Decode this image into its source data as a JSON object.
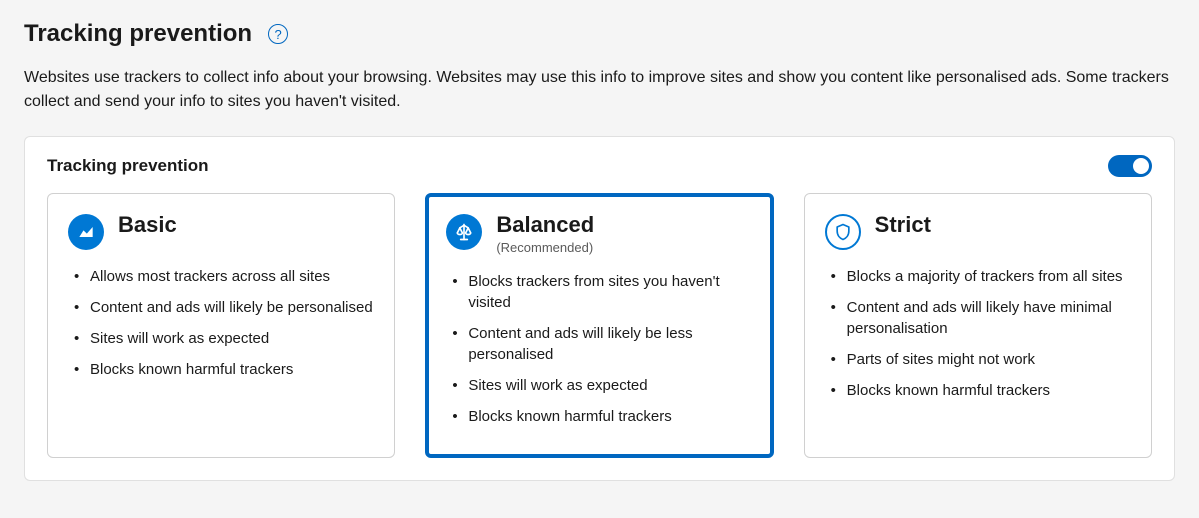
{
  "header": {
    "title": "Tracking prevention",
    "description": "Websites use trackers to collect info about your browsing. Websites may use this info to improve sites and show you content like personalised ads. Some trackers collect and send your info to sites you haven't visited."
  },
  "card": {
    "title": "Tracking prevention",
    "toggle_on": true
  },
  "options": [
    {
      "id": "basic",
      "title": "Basic",
      "subtitle": "",
      "selected": false,
      "bullets": [
        "Allows most trackers across all sites",
        "Content and ads will likely be personalised",
        "Sites will work as expected",
        "Blocks known harmful trackers"
      ]
    },
    {
      "id": "balanced",
      "title": "Balanced",
      "subtitle": "(Recommended)",
      "selected": true,
      "bullets": [
        "Blocks trackers from sites you haven't visited",
        "Content and ads will likely be less personalised",
        "Sites will work as expected",
        "Blocks known harmful trackers"
      ]
    },
    {
      "id": "strict",
      "title": "Strict",
      "subtitle": "",
      "selected": false,
      "bullets": [
        "Blocks a majority of trackers from all sites",
        "Content and ads will likely have minimal personalisation",
        "Parts of sites might not work",
        "Blocks known harmful trackers"
      ]
    }
  ]
}
